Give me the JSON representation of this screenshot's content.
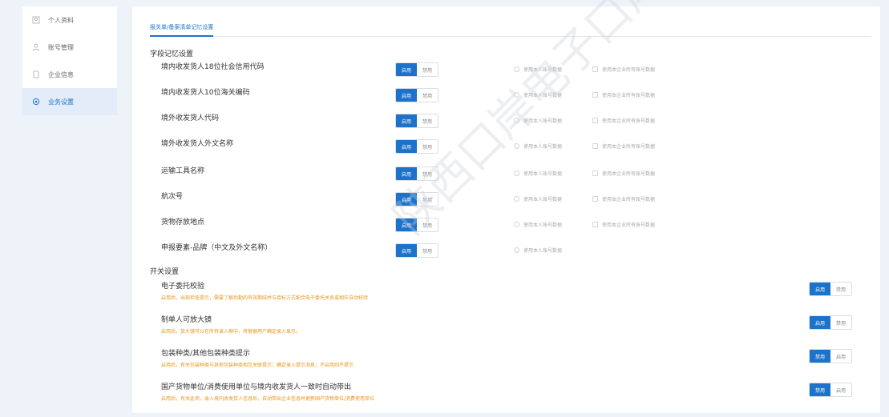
{
  "sidebar": {
    "items": [
      {
        "label": "个人资料",
        "icon": "user-profile-icon"
      },
      {
        "label": "账号管理",
        "icon": "person-icon"
      },
      {
        "label": "企业信息",
        "icon": "document-icon"
      },
      {
        "label": "业务设置",
        "icon": "gear-icon"
      }
    ],
    "active_index": 3
  },
  "main": {
    "tab_label": "报关单/备案清单记忆设置",
    "memory_section_title": "字段记忆设置",
    "switch_section_title": "开关设置",
    "toggle_labels": {
      "on": "启用",
      "off": "禁用"
    },
    "radio_label": "使用本人账号数据",
    "check_label": "使用本企业所有账号数据",
    "fields": [
      {
        "label": "境内收发货人18位社会信用代码",
        "enabled": true,
        "show_options": true
      },
      {
        "label": "境内收发货人10位海关编码",
        "enabled": true,
        "show_options": true
      },
      {
        "label": "境外收发货人代码",
        "enabled": true,
        "show_options": true
      },
      {
        "label": "境外收发货人外文名称",
        "enabled": true,
        "show_options": true
      },
      {
        "label": "运输工具名称",
        "enabled": true,
        "show_options": true
      },
      {
        "label": "航次号",
        "enabled": true,
        "show_options": true
      },
      {
        "label": "货物存放地点",
        "enabled": true,
        "show_options": true
      },
      {
        "label": "申报要素-品牌（中文及外文名称）",
        "enabled": true,
        "show_options": false
      }
    ],
    "switches": [
      {
        "label": "电子委托校验",
        "hint": "启用后，出现检查提示，需要了解后勤的有效期结并与目标方式配合电子委托关系或相应自动校验",
        "enabled": true
      },
      {
        "label": "制单人可放大镜",
        "hint": "启用后，放大镜可以在所有录入框中，将根据用户确定录入显示。",
        "enabled": true
      },
      {
        "label": "包装种类/其他包装种类提示",
        "hint": "启用后，有关包装种类与其他包装种类相互关联提示；确定录入提示消息；不启用则不提示",
        "enabled": false
      },
      {
        "label": "国产货物单位/消费使用单位与境内收发货人一致时自动带出",
        "hint": "启用后，有关此项，录入境内收发货人信息后，自动带出企业信息并更新国产货物单位/消费使用单位",
        "enabled": false
      }
    ]
  },
  "watermark": "陕西口岸电子口岸有限责任公司"
}
